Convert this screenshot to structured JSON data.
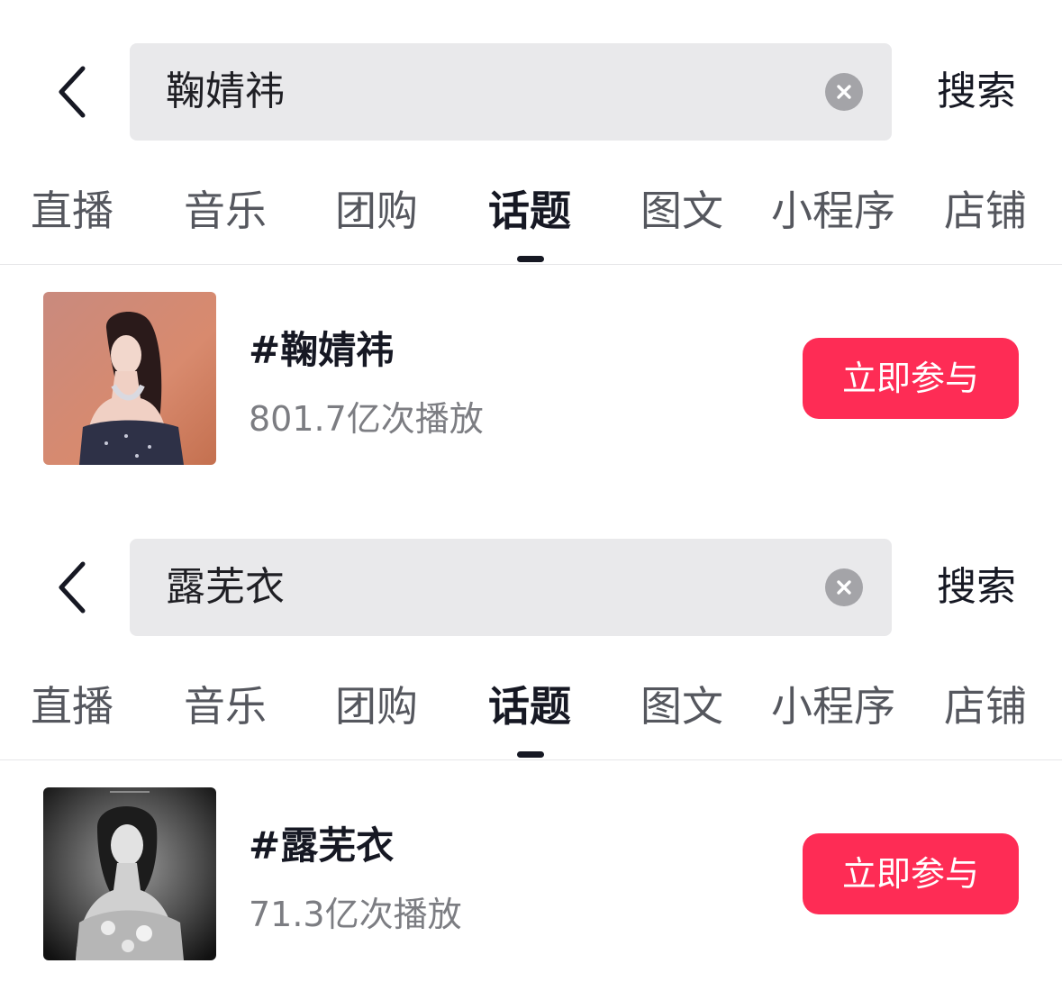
{
  "panels": [
    {
      "search": {
        "query": "鞠婧祎",
        "submit_label": "搜索"
      },
      "tabs": [
        "直播",
        "音乐",
        "团购",
        "话题",
        "图文",
        "小程序",
        "店铺"
      ],
      "active_tab": "话题",
      "result": {
        "title": "#鞠婧祎",
        "play_count": "801.7亿次播放",
        "join_label": "立即参与",
        "thumbnail": "photo-woman-sequin-dress-warm-background"
      }
    },
    {
      "search": {
        "query": "露芜衣",
        "submit_label": "搜索"
      },
      "tabs": [
        "直播",
        "音乐",
        "团购",
        "话题",
        "图文",
        "小程序",
        "店铺"
      ],
      "active_tab": "话题",
      "result": {
        "title": "#露芜衣",
        "play_count": "71.3亿次播放",
        "join_label": "立即参与",
        "thumbnail": "photo-woman-black-and-white"
      }
    }
  ],
  "icons": {
    "back": "chevron-left-icon",
    "clear": "clear-circle-icon"
  },
  "colors": {
    "accent": "#fe2c55",
    "search_bg": "#e9e9eb",
    "text_primary": "#161823",
    "text_secondary": "#7c7d82"
  }
}
